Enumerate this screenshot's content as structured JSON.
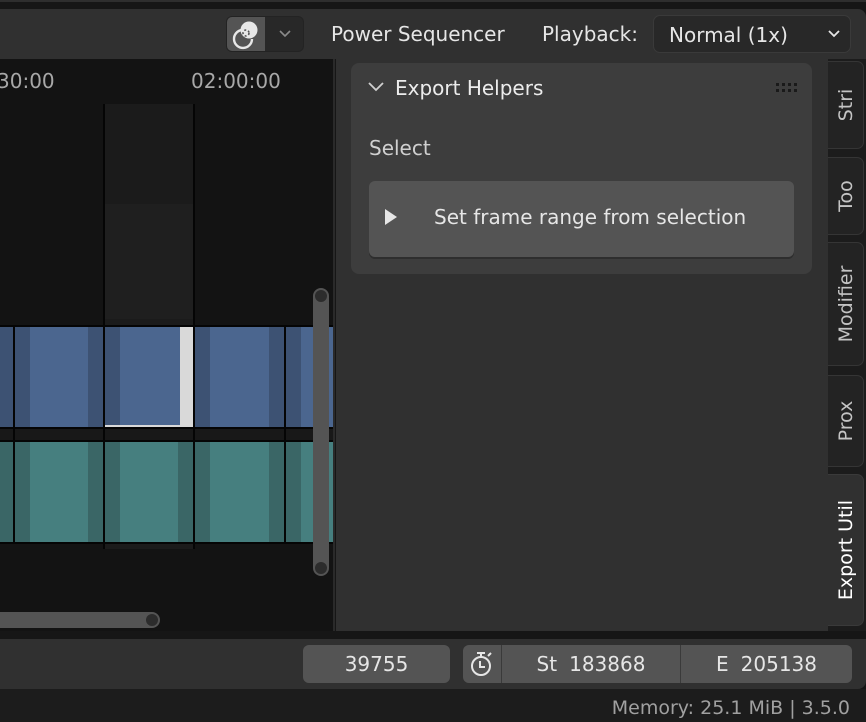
{
  "header": {
    "overlay_icon": "overlay-circles-icon",
    "dropdown_icon": "chevron-down-icon",
    "addon_label": "Power Sequencer",
    "playback_label": "Playback:",
    "playback_value": "Normal (1x)"
  },
  "timeline": {
    "ruler_labels": [
      "30:00",
      "02:00:00"
    ],
    "channels": [
      {
        "name": "video-channel",
        "color": "#4b668f",
        "handle_color": "#3d5273"
      },
      {
        "name": "audio-channel",
        "color": "#467f7f",
        "handle_color": "#3a6666"
      }
    ],
    "selected_strip_handle_color": "#d9d9d9"
  },
  "panel": {
    "title": "Export Helpers",
    "collapse_icon": "chevron-down-icon",
    "grip_icon": "drag-grip-icon",
    "section_label": "Select",
    "operator_button": {
      "icon": "play-triangle-icon",
      "label": "Set frame range from selection"
    }
  },
  "tabs": [
    {
      "label": "Stri",
      "active": false
    },
    {
      "label": "Too",
      "active": false
    },
    {
      "label": "Modifier",
      "active": false
    },
    {
      "label": "Prox",
      "active": false
    },
    {
      "label": "Export Util",
      "active": true
    }
  ],
  "playbar": {
    "current_frame": "39755",
    "timer_icon": "stopwatch-icon",
    "start_key": "St",
    "start_value": "183868",
    "end_key": "E",
    "end_value": "205138"
  },
  "status": {
    "text": "Memory: 25.1 MiB | 3.5.0"
  }
}
